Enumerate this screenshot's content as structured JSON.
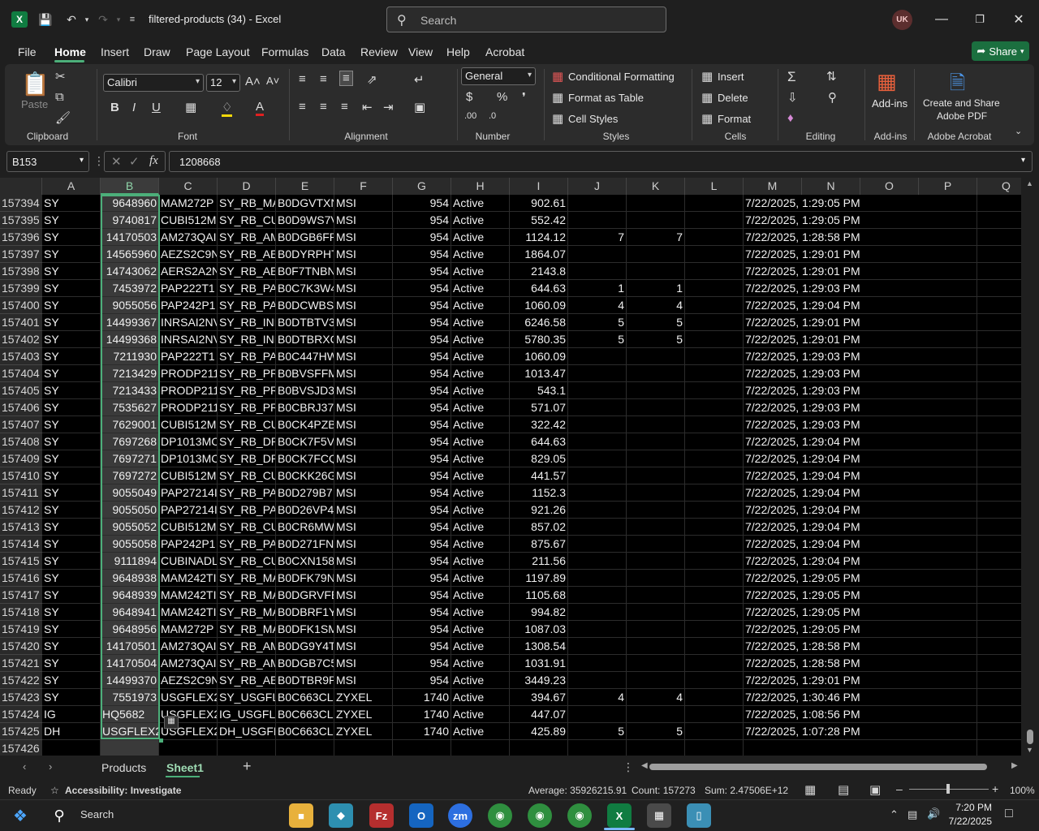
{
  "titlebar": {
    "doc_title": "filtered-products (34)  -  Excel",
    "search_placeholder": "Search",
    "avatar_initials": "UK"
  },
  "tabs": [
    "File",
    "Home",
    "Insert",
    "Draw",
    "Page Layout",
    "Formulas",
    "Data",
    "Review",
    "View",
    "Help",
    "Acrobat"
  ],
  "share_label": "Share",
  "ribbon": {
    "clipboard": {
      "paste": "Paste",
      "label": "Clipboard"
    },
    "font": {
      "family": "Calibri",
      "size": "12",
      "label": "Font"
    },
    "alignment": {
      "label": "Alignment"
    },
    "number": {
      "format": "General",
      "label": "Number"
    },
    "styles": {
      "conditional": "Conditional Formatting",
      "format_table": "Format as Table",
      "cell_styles": "Cell Styles",
      "label": "Styles"
    },
    "cells": {
      "insert": "Insert",
      "delete": "Delete",
      "format": "Format",
      "label": "Cells"
    },
    "editing": {
      "label": "Editing"
    },
    "addins": {
      "button": "Add-ins",
      "label": "Add-ins"
    },
    "acrobat": {
      "button_line1": "Create and Share",
      "button_line2": "Adobe PDF",
      "label": "Adobe Acrobat"
    }
  },
  "formula": {
    "namebox": "B153",
    "value": "1208668"
  },
  "columns": [
    "A",
    "B",
    "C",
    "D",
    "E",
    "F",
    "G",
    "H",
    "I",
    "J",
    "K",
    "L",
    "M",
    "N",
    "O",
    "P",
    "Q"
  ],
  "rows": [
    {
      "n": "157394",
      "a": "SY",
      "b": "9648960",
      "c": "MAM272P",
      "d": "SY_RB_MA",
      "e": "B0DGVTXN",
      "f": "MSI",
      "g": "954",
      "h": "Active",
      "i": "902.61",
      "j": "",
      "k": "",
      "m": "7/22/2025, 1:29:05 PM"
    },
    {
      "n": "157395",
      "a": "SY",
      "b": "9740817",
      "c": "CUBI512M",
      "d": "SY_RB_CU",
      "e": "B0D9WS7V",
      "f": "MSI",
      "g": "954",
      "h": "Active",
      "i": "552.42",
      "j": "",
      "k": "",
      "m": "7/22/2025, 1:29:05 PM"
    },
    {
      "n": "157396",
      "a": "SY",
      "b": "14170503",
      "c": "AM273QAI",
      "d": "SY_RB_AM",
      "e": "B0DGB6FP",
      "f": "MSI",
      "g": "954",
      "h": "Active",
      "i": "1124.12",
      "j": "7",
      "k": "7",
      "m": "7/22/2025, 1:28:58 PM"
    },
    {
      "n": "157397",
      "a": "SY",
      "b": "14565960",
      "c": "AEZS2C9N",
      "d": "SY_RB_AEZ",
      "e": "B0DYRPHT",
      "f": "MSI",
      "g": "954",
      "h": "Active",
      "i": "1864.07",
      "j": "",
      "k": "",
      "m": "7/22/2025, 1:29:01 PM"
    },
    {
      "n": "157398",
      "a": "SY",
      "b": "14743062",
      "c": "AERS2A2N",
      "d": "SY_RB_AEI",
      "e": "B0F7TNBN",
      "f": "MSI",
      "g": "954",
      "h": "Active",
      "i": "2143.8",
      "j": "",
      "k": "",
      "m": "7/22/2025, 1:29:01 PM"
    },
    {
      "n": "157399",
      "a": "SY",
      "b": "7453972",
      "c": "PAP222T1",
      "d": "SY_RB_PAI",
      "e": "B0C7K3W4",
      "f": "MSI",
      "g": "954",
      "h": "Active",
      "i": "644.63",
      "j": "1",
      "k": "1",
      "m": "7/22/2025, 1:29:03 PM"
    },
    {
      "n": "157400",
      "a": "SY",
      "b": "9055056",
      "c": "PAP242P1",
      "d": "SY_RB_PAI",
      "e": "B0DCWBSJ",
      "f": "MSI",
      "g": "954",
      "h": "Active",
      "i": "1060.09",
      "j": "4",
      "k": "4",
      "m": "7/22/2025, 1:29:04 PM"
    },
    {
      "n": "157401",
      "a": "SY",
      "b": "14499367",
      "c": "INRSAI2NV",
      "d": "SY_RB_INF",
      "e": "B0DTBTV3",
      "f": "MSI",
      "g": "954",
      "h": "Active",
      "i": "6246.58",
      "j": "5",
      "k": "5",
      "m": "7/22/2025, 1:29:01 PM"
    },
    {
      "n": "157402",
      "a": "SY",
      "b": "14499368",
      "c": "INRSAI2NV",
      "d": "SY_RB_INF",
      "e": "B0DTBRXC",
      "f": "MSI",
      "g": "954",
      "h": "Active",
      "i": "5780.35",
      "j": "5",
      "k": "5",
      "m": "7/22/2025, 1:29:01 PM"
    },
    {
      "n": "157403",
      "a": "SY",
      "b": "7211930",
      "c": "PAP222T1",
      "d": "SY_RB_PAI",
      "e": "B0C447HW",
      "f": "MSI",
      "g": "954",
      "h": "Active",
      "i": "1060.09",
      "j": "",
      "k": "",
      "m": "7/22/2025, 1:29:03 PM"
    },
    {
      "n": "157404",
      "a": "SY",
      "b": "7213429",
      "c": "PRODP211",
      "d": "SY_RB_PR",
      "e": "B0BVSFFM",
      "f": "MSI",
      "g": "954",
      "h": "Active",
      "i": "1013.47",
      "j": "",
      "k": "",
      "m": "7/22/2025, 1:29:03 PM"
    },
    {
      "n": "157405",
      "a": "SY",
      "b": "7213433",
      "c": "PRODP211",
      "d": "SY_RB_PR",
      "e": "B0BVSJD3",
      "f": "MSI",
      "g": "954",
      "h": "Active",
      "i": "543.1",
      "j": "",
      "k": "",
      "m": "7/22/2025, 1:29:03 PM"
    },
    {
      "n": "157406",
      "a": "SY",
      "b": "7535627",
      "c": "PRODP211",
      "d": "SY_RB_PR",
      "e": "B0CBRJ37V",
      "f": "MSI",
      "g": "954",
      "h": "Active",
      "i": "571.07",
      "j": "",
      "k": "",
      "m": "7/22/2025, 1:29:03 PM"
    },
    {
      "n": "157407",
      "a": "SY",
      "b": "7629001",
      "c": "CUBI512M",
      "d": "SY_RB_CU",
      "e": "B0CK4PZB",
      "f": "MSI",
      "g": "954",
      "h": "Active",
      "i": "322.42",
      "j": "",
      "k": "",
      "m": "7/22/2025, 1:29:03 PM"
    },
    {
      "n": "157408",
      "a": "SY",
      "b": "7697268",
      "c": "DP1013MC",
      "d": "SY_RB_DP",
      "e": "B0CK7F5V",
      "f": "MSI",
      "g": "954",
      "h": "Active",
      "i": "644.63",
      "j": "",
      "k": "",
      "m": "7/22/2025, 1:29:04 PM"
    },
    {
      "n": "157409",
      "a": "SY",
      "b": "7697271",
      "c": "DP1013MC",
      "d": "SY_RB_DP",
      "e": "B0CK7FCQ",
      "f": "MSI",
      "g": "954",
      "h": "Active",
      "i": "829.05",
      "j": "",
      "k": "",
      "m": "7/22/2025, 1:29:04 PM"
    },
    {
      "n": "157410",
      "a": "SY",
      "b": "7697272",
      "c": "CUBI512M",
      "d": "SY_RB_CU",
      "e": "B0CKK26G",
      "f": "MSI",
      "g": "954",
      "h": "Active",
      "i": "441.57",
      "j": "",
      "k": "",
      "m": "7/22/2025, 1:29:04 PM"
    },
    {
      "n": "157411",
      "a": "SY",
      "b": "9055049",
      "c": "PAP27214I",
      "d": "SY_RB_PAI",
      "e": "B0D279B7",
      "f": "MSI",
      "g": "954",
      "h": "Active",
      "i": "1152.3",
      "j": "",
      "k": "",
      "m": "7/22/2025, 1:29:04 PM"
    },
    {
      "n": "157412",
      "a": "SY",
      "b": "9055050",
      "c": "PAP27214I",
      "d": "SY_RB_PAI",
      "e": "B0D26VP4",
      "f": "MSI",
      "g": "954",
      "h": "Active",
      "i": "921.26",
      "j": "",
      "k": "",
      "m": "7/22/2025, 1:29:04 PM"
    },
    {
      "n": "157413",
      "a": "SY",
      "b": "9055052",
      "c": "CUBI512M",
      "d": "SY_RB_CU",
      "e": "B0CR6MW",
      "f": "MSI",
      "g": "954",
      "h": "Active",
      "i": "857.02",
      "j": "",
      "k": "",
      "m": "7/22/2025, 1:29:04 PM"
    },
    {
      "n": "157414",
      "a": "SY",
      "b": "9055058",
      "c": "PAP242P1",
      "d": "SY_RB_PAI",
      "e": "B0D271FN",
      "f": "MSI",
      "g": "954",
      "h": "Active",
      "i": "875.67",
      "j": "",
      "k": "",
      "m": "7/22/2025, 1:29:04 PM"
    },
    {
      "n": "157415",
      "a": "SY",
      "b": "9111894",
      "c": "CUBINADL",
      "d": "SY_RB_CU",
      "e": "B0CXN158",
      "f": "MSI",
      "g": "954",
      "h": "Active",
      "i": "211.56",
      "j": "",
      "k": "",
      "m": "7/22/2025, 1:29:04 PM"
    },
    {
      "n": "157416",
      "a": "SY",
      "b": "9648938",
      "c": "MAM242TI",
      "d": "SY_RB_MA",
      "e": "B0DFK79N",
      "f": "MSI",
      "g": "954",
      "h": "Active",
      "i": "1197.89",
      "j": "",
      "k": "",
      "m": "7/22/2025, 1:29:05 PM"
    },
    {
      "n": "157417",
      "a": "SY",
      "b": "9648939",
      "c": "MAM242TI",
      "d": "SY_RB_MA",
      "e": "B0DGRVFE",
      "f": "MSI",
      "g": "954",
      "h": "Active",
      "i": "1105.68",
      "j": "",
      "k": "",
      "m": "7/22/2025, 1:29:05 PM"
    },
    {
      "n": "157418",
      "a": "SY",
      "b": "9648941",
      "c": "MAM242TI",
      "d": "SY_RB_MA",
      "e": "B0DBRF1Y",
      "f": "MSI",
      "g": "954",
      "h": "Active",
      "i": "994.82",
      "j": "",
      "k": "",
      "m": "7/22/2025, 1:29:05 PM"
    },
    {
      "n": "157419",
      "a": "SY",
      "b": "9648956",
      "c": "MAM272P",
      "d": "SY_RB_MA",
      "e": "B0DFK1SM",
      "f": "MSI",
      "g": "954",
      "h": "Active",
      "i": "1087.03",
      "j": "",
      "k": "",
      "m": "7/22/2025, 1:29:05 PM"
    },
    {
      "n": "157420",
      "a": "SY",
      "b": "14170501",
      "c": "AM273QAI",
      "d": "SY_RB_AM",
      "e": "B0DG9Y4T",
      "f": "MSI",
      "g": "954",
      "h": "Active",
      "i": "1308.54",
      "j": "",
      "k": "",
      "m": "7/22/2025, 1:28:58 PM"
    },
    {
      "n": "157421",
      "a": "SY",
      "b": "14170504",
      "c": "AM273QAI",
      "d": "SY_RB_AM",
      "e": "B0DGB7C5",
      "f": "MSI",
      "g": "954",
      "h": "Active",
      "i": "1031.91",
      "j": "",
      "k": "",
      "m": "7/22/2025, 1:28:58 PM"
    },
    {
      "n": "157422",
      "a": "SY",
      "b": "14499370",
      "c": "AEZS2C9N",
      "d": "SY_RB_AEZ",
      "e": "B0DTBR9P",
      "f": "MSI",
      "g": "954",
      "h": "Active",
      "i": "3449.23",
      "j": "",
      "k": "",
      "m": "7/22/2025, 1:29:01 PM"
    },
    {
      "n": "157423",
      "a": "SY",
      "b": "7551973",
      "c": "USGFLEX2",
      "d": "SY_USGFLE",
      "e": "B0C663CL",
      "f": "ZYXEL",
      "g": "1740",
      "h": "Active",
      "i": "394.67",
      "j": "4",
      "k": "4",
      "m": "7/22/2025, 1:30:46 PM"
    },
    {
      "n": "157424",
      "a": "IG",
      "b": "HQ5682",
      "c": "USGFLEX2",
      "d": "IG_USGFLE",
      "e": "B0C663CL",
      "f": "ZYXEL",
      "g": "1740",
      "h": "Active",
      "i": "447.07",
      "j": "",
      "k": "",
      "m": "7/22/2025, 1:08:56 PM"
    },
    {
      "n": "157425",
      "a": "DH",
      "b": "USGFLEX20",
      "c": "USGFLEX2",
      "d": "DH_USGFLE",
      "e": "B0C663CL",
      "f": "ZYXEL",
      "g": "1740",
      "h": "Active",
      "i": "425.89",
      "j": "5",
      "k": "5",
      "m": "7/22/2025, 1:07:28 PM"
    },
    {
      "n": "157426",
      "a": "",
      "b": "",
      "c": "",
      "d": "",
      "e": "",
      "f": "",
      "g": "",
      "h": "",
      "i": "",
      "j": "",
      "k": "",
      "m": ""
    }
  ],
  "sheets": {
    "tab1": "Products",
    "tab2": "Sheet1"
  },
  "status": {
    "ready": "Ready",
    "accessibility": "Accessibility: Investigate",
    "average": "Average: 35926215.91",
    "count": "Count: 157273",
    "sum": "Sum: 2.47506E+12",
    "zoom": "100%"
  },
  "taskbar": {
    "search": "Search",
    "time": "7:20 PM",
    "date": "7/22/2025"
  }
}
